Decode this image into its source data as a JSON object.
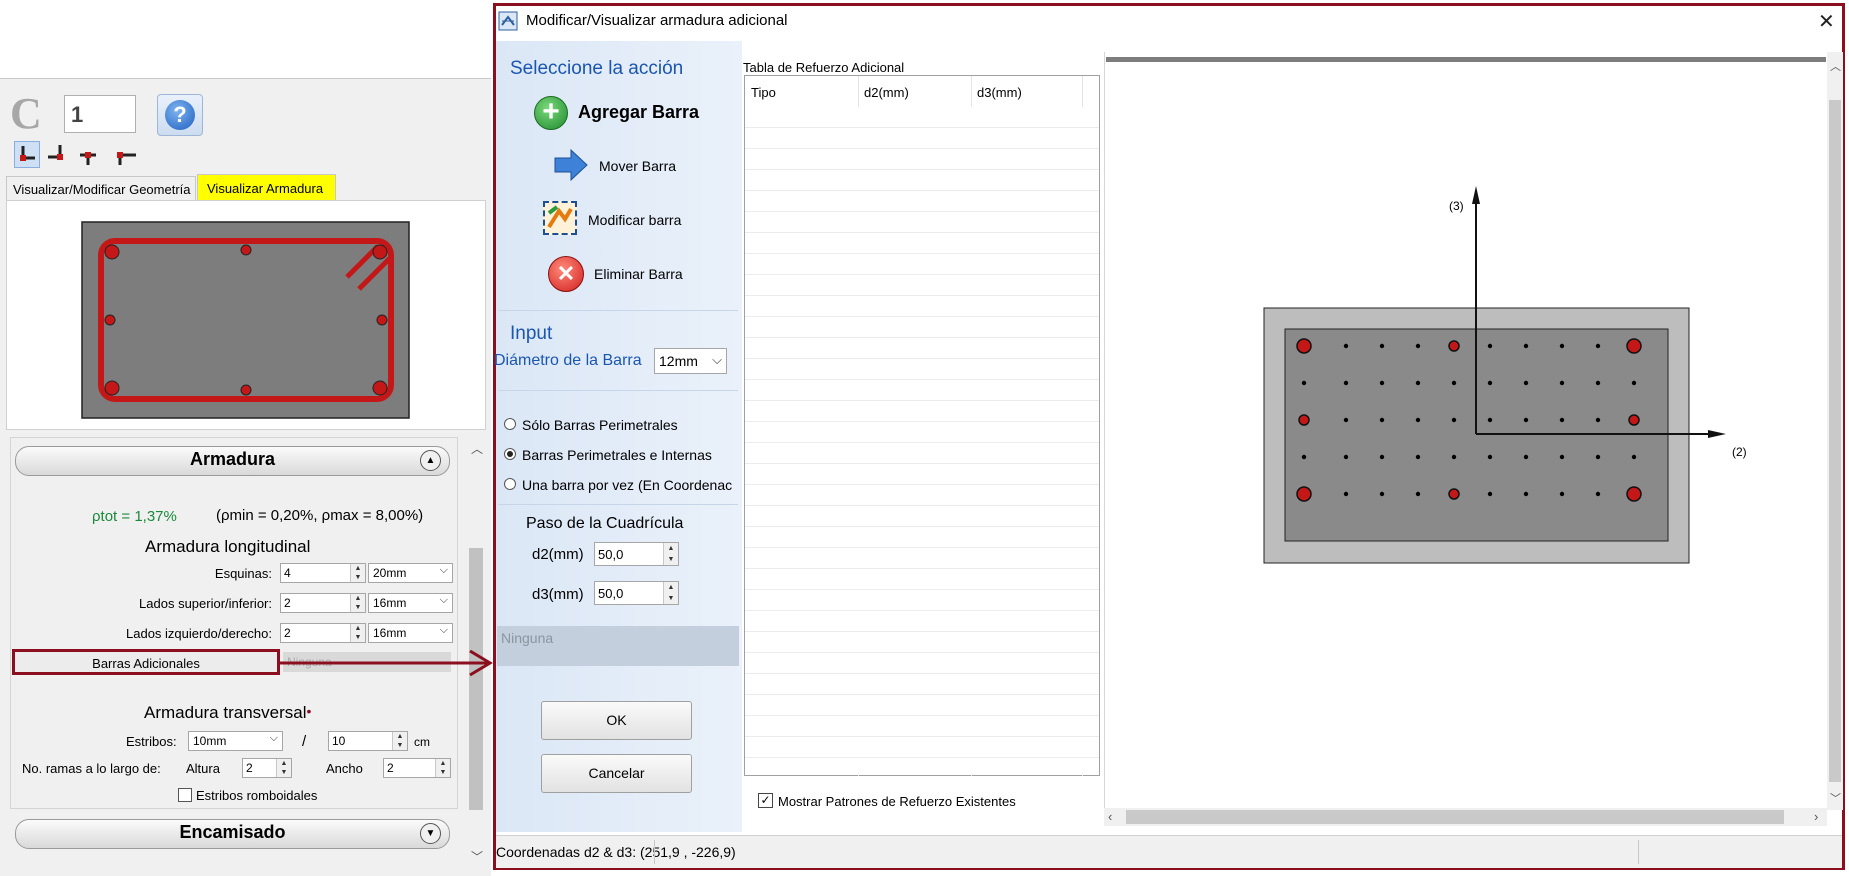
{
  "left": {
    "c_label": "C",
    "c_number": "1",
    "help_icon": "question-icon",
    "tabs": [
      {
        "label": "Visualizar/Modificar Geometría",
        "active": false
      },
      {
        "label": "Visualizar Armadura",
        "active": true
      }
    ],
    "armadura_header": "Armadura",
    "rho": {
      "tot_label": "ρtot",
      "tot_eq": " = 1,37%",
      "range_text": "(ρmin = 0,20%, ρmax = 8,00%)"
    },
    "long_title": "Armadura longitudinal",
    "rows": [
      {
        "label": "Esquinas:",
        "count": "4",
        "diam": "20mm"
      },
      {
        "label": "Lados superior/inferior:",
        "count": "2",
        "diam": "16mm"
      },
      {
        "label": "Lados izquierdo/derecho:",
        "count": "2",
        "diam": "16mm"
      }
    ],
    "barras_adicionales_label": "Barras Adicionales",
    "barras_adicionales_value": "Ninguna",
    "trans_title": "Armadura transversal",
    "estribos_label": "Estribos:",
    "estribos_diam": "10mm",
    "estribos_sep_slash": "/",
    "estribos_sep": "10",
    "estribos_unit": "cm",
    "ramas_label": "No. ramas a lo largo de:",
    "altura_label": "Altura",
    "altura_val": "2",
    "ancho_label": "Ancho",
    "ancho_val": "2",
    "romboidales_label": "Estribos romboidales",
    "encamisado_header": "Encamisado"
  },
  "dialog": {
    "title": "Modificar/Visualizar armadura adicional",
    "close_icon": "close-icon",
    "accion_title": "Seleccione la acción",
    "actions": [
      {
        "label": "Agregar Barra",
        "icon": "plus-circle-icon"
      },
      {
        "label": "Mover Barra",
        "icon": "arrow-right-icon"
      },
      {
        "label": "Modificar barra",
        "icon": "modify-icon"
      },
      {
        "label": "Eliminar Barra",
        "icon": "delete-circle-icon"
      }
    ],
    "input_title": "Input",
    "diam_label": "Diámetro de la Barra",
    "diam_value": "12mm",
    "options": [
      {
        "label": "Sólo Barras Perimetrales",
        "checked": false
      },
      {
        "label": "Barras Perimetrales e Internas",
        "checked": true
      },
      {
        "label": "Una barra por vez (En Coordenac",
        "checked": false
      }
    ],
    "paso_title": "Paso de la Cuadrícula",
    "d2_label": "d2(mm)",
    "d2_value": "50,0",
    "d3_label": "d3(mm)",
    "d3_value": "50,0",
    "ninguna_label": "Ninguna",
    "ok_label": "OK",
    "cancel_label": "Cancelar",
    "table_title": "Tabla de Refuerzo Adicional",
    "table_headers": [
      "Tipo",
      "d2(mm)",
      "d3(mm)"
    ],
    "mostrar_label": "Mostrar Patrones de Refuerzo Existentes",
    "mostrar_checked": true,
    "axis3_label": "(3)",
    "axis2_label": "(2)",
    "status": "Coordenadas d2 & d3: (251,9 , -226,9)"
  },
  "colors": {
    "frame": "#8b0f1f",
    "accent_blue": "#1a56b0",
    "rebar": "#c41818",
    "green_rho": "#1a8a3a",
    "tab_highlight": "#ffff00"
  }
}
